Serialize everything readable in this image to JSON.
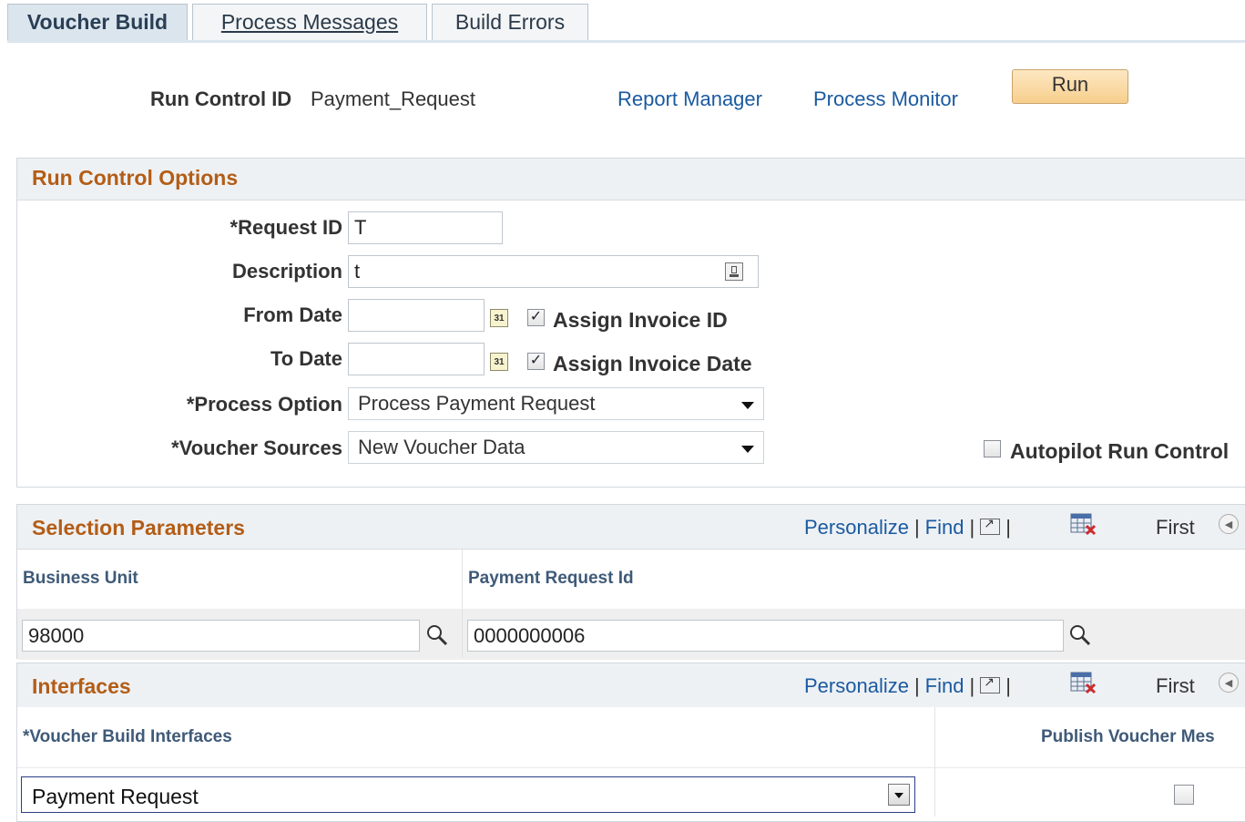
{
  "tabs": [
    {
      "label": "Voucher Build",
      "active": true
    },
    {
      "label": "Process Messages",
      "active": false
    },
    {
      "label": "Build Errors",
      "active": false
    }
  ],
  "header": {
    "run_control_label": "Run Control ID",
    "run_control_value": "Payment_Request",
    "report_manager": "Report Manager",
    "process_monitor": "Process Monitor",
    "run_button": "Run"
  },
  "run_control_options": {
    "title": "Run Control Options",
    "request_id": {
      "label": "*Request ID",
      "value": "T"
    },
    "description": {
      "label": "Description",
      "value": "t"
    },
    "from_date": {
      "label": "From Date",
      "value": ""
    },
    "to_date": {
      "label": "To Date",
      "value": ""
    },
    "assign_invoice_id": {
      "label": "Assign Invoice ID",
      "checked": true
    },
    "assign_invoice_date": {
      "label": "Assign Invoice Date",
      "checked": true
    },
    "process_option": {
      "label": "*Process Option",
      "value": "Process Payment Request"
    },
    "voucher_sources": {
      "label": "*Voucher Sources",
      "value": "New Voucher Data"
    },
    "autopilot": {
      "label": "Autopilot Run Control",
      "checked": false
    },
    "calendar_glyph": "31"
  },
  "grid_tools": {
    "personalize": "Personalize",
    "find": "Find",
    "separator": "|",
    "first": "First"
  },
  "selection_parameters": {
    "title": "Selection Parameters",
    "columns": [
      "Business Unit",
      "Payment Request Id"
    ],
    "rows": [
      {
        "business_unit": "98000",
        "payment_request_id": "0000000006"
      }
    ]
  },
  "interfaces": {
    "title": "Interfaces",
    "columns": [
      "*Voucher Build Interfaces",
      "Publish Voucher Mes"
    ],
    "rows": [
      {
        "interface": "Payment Request",
        "publish": false
      }
    ]
  },
  "colors": {
    "section_title": "#b35d16",
    "link": "#1a5aa0",
    "tab_active_bg": "#dbe5ee",
    "header_bg": "#eef1f4",
    "run_button_bg": "#f7cf8d"
  }
}
